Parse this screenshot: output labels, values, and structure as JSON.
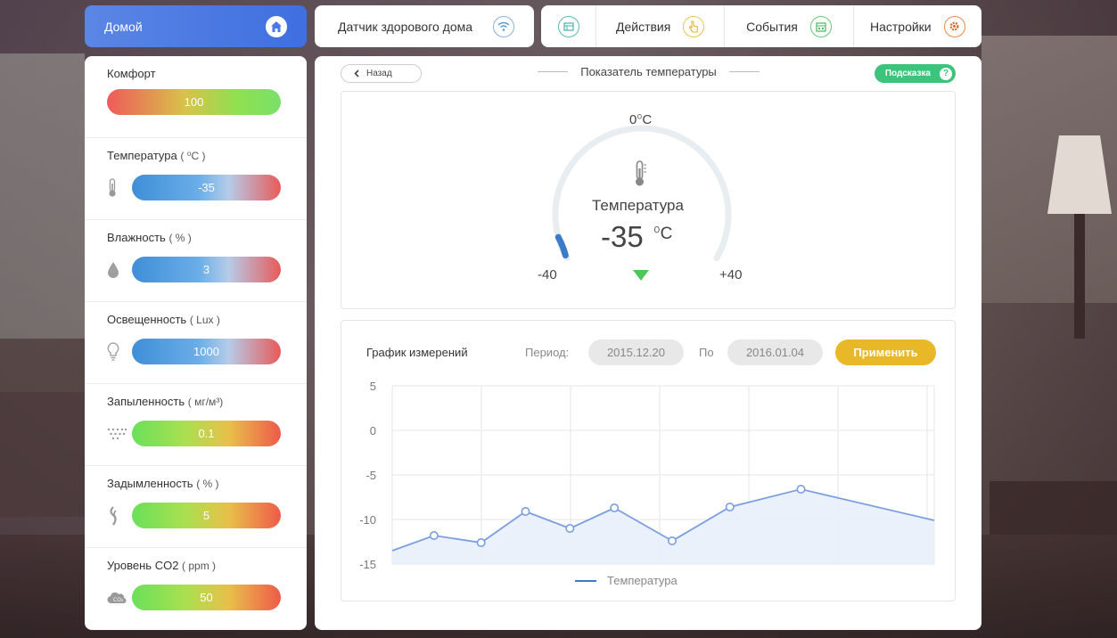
{
  "header": {
    "home_label": "Домой",
    "sensor_label": "Датчик здорового дома",
    "nav": [
      {
        "label": ""
      },
      {
        "label": "Действия"
      },
      {
        "label": "События"
      },
      {
        "label": "Настройки"
      }
    ]
  },
  "sidebar": {
    "items": [
      {
        "title": "Комфорт",
        "unit": "",
        "value": "100"
      },
      {
        "title": "Температура",
        "unit": "( ⁰C )",
        "value": "-35"
      },
      {
        "title": "Влажность",
        "unit": "( % )",
        "value": "3"
      },
      {
        "title": "Освещенность",
        "unit": "( Lux )",
        "value": "1000"
      },
      {
        "title": "Запыленность",
        "unit": "( мг/м³)",
        "value": "0.1"
      },
      {
        "title": "Задымленность",
        "unit": "( % )",
        "value": "5"
      },
      {
        "title": "Уровень CO2",
        "unit": "( ppm )",
        "value": "50"
      }
    ]
  },
  "main": {
    "back_label": "Назад",
    "title": "Показатель температуры",
    "hint_label": "Подсказка",
    "hint_icon": "?",
    "gauge": {
      "top_label": "0⁰C",
      "name": "Температура",
      "value": "-35",
      "unit": "⁰C",
      "min_label": "-40",
      "max_label": "+40",
      "min": -40,
      "max": 40,
      "current": -35,
      "arc_color": "#3a7ac8",
      "marker_color": "#4cc85a"
    },
    "chart": {
      "title": "График измерений",
      "period_label": "Период:",
      "from_date": "2015.12.20",
      "to_label": "По",
      "to_date": "2016.01.04",
      "apply_label": "Применить"
    }
  },
  "chart_data": {
    "type": "area",
    "title": "",
    "xlabel": "",
    "ylabel": "",
    "ylim": [
      -15,
      5
    ],
    "yticks": [
      5,
      0,
      -5,
      -10,
      -15
    ],
    "x": [
      0,
      0.47,
      1,
      1.5,
      2,
      2.5,
      3.15,
      3.8,
      4.6,
      6.1
    ],
    "series": [
      {
        "name": "Температура",
        "values": [
          -13.5,
          -11.8,
          -12.6,
          -9.1,
          -11,
          -8.7,
          -12.4,
          -8.6,
          -6.6,
          -10.1
        ],
        "markers": [
          false,
          true,
          true,
          true,
          true,
          true,
          true,
          true,
          true,
          false
        ],
        "color": "#7a9ee0"
      }
    ],
    "grid": true,
    "legend": "bottom-center"
  }
}
